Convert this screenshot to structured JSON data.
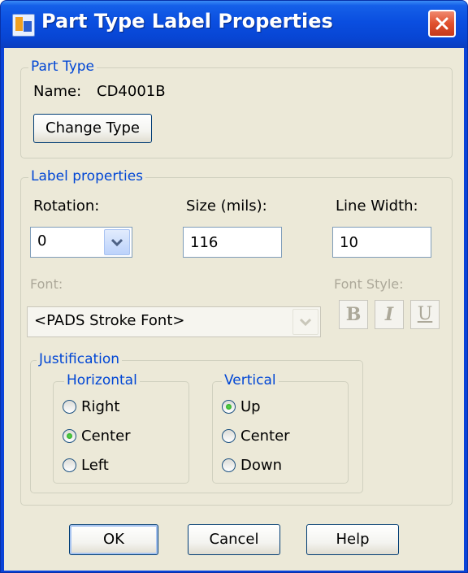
{
  "window": {
    "title": "Part Type Label Properties"
  },
  "part_type": {
    "legend": "Part Type",
    "name_label": "Name:",
    "name_value": "CD4001B",
    "change_type_button": "Change Type"
  },
  "label_props": {
    "legend": "Label properties",
    "rotation": {
      "label": "Rotation:",
      "value": "0"
    },
    "size": {
      "label": "Size (mils):",
      "value": "116"
    },
    "line_width": {
      "label": "Line Width:",
      "value": "10"
    },
    "font": {
      "label": "Font:",
      "value": "<PADS Stroke Font>"
    },
    "font_style": {
      "label": "Font Style:",
      "bold": "B",
      "italic": "I",
      "underline": "U"
    },
    "justification": {
      "legend": "Justification",
      "horizontal": {
        "legend": "Horizontal",
        "options": [
          "Right",
          "Center",
          "Left"
        ],
        "selected": "Center"
      },
      "vertical": {
        "legend": "Vertical",
        "options": [
          "Up",
          "Center",
          "Down"
        ],
        "selected": "Up"
      }
    }
  },
  "buttons": {
    "ok": "OK",
    "cancel": "Cancel",
    "help": "Help"
  },
  "icons": {
    "close": "close-icon",
    "app": "app-icon",
    "dropdown": "chevron-down-icon"
  },
  "colors": {
    "title_bar": "#0a4ee0",
    "group_legend": "#0046d5",
    "dialog_bg": "#ece9d8",
    "close_button": "#e0502e"
  }
}
